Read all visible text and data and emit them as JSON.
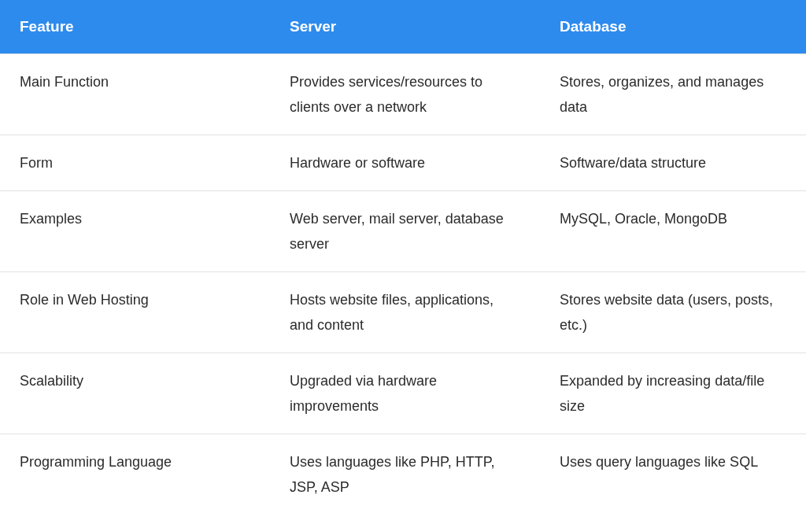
{
  "table": {
    "columns": [
      "Feature",
      "Server",
      "Database"
    ],
    "rows": [
      [
        "Main Function",
        "Provides services/resources to clients over a network",
        "Stores, organizes, and manages data"
      ],
      [
        "Form",
        "Hardware or software",
        "Software/data structure"
      ],
      [
        "Examples",
        "Web server, mail server, database server",
        "MySQL, Oracle, MongoDB"
      ],
      [
        "Role in Web Hosting",
        "Hosts website files, applications, and content",
        "Stores website data (users, posts, etc.)"
      ],
      [
        "Scalability",
        "Upgraded via hardware improvements",
        "Expanded by increasing data/file size"
      ],
      [
        "Programming Language",
        "Uses languages like PHP, HTTP, JSP, ASP",
        "Uses query languages like SQL"
      ]
    ]
  }
}
